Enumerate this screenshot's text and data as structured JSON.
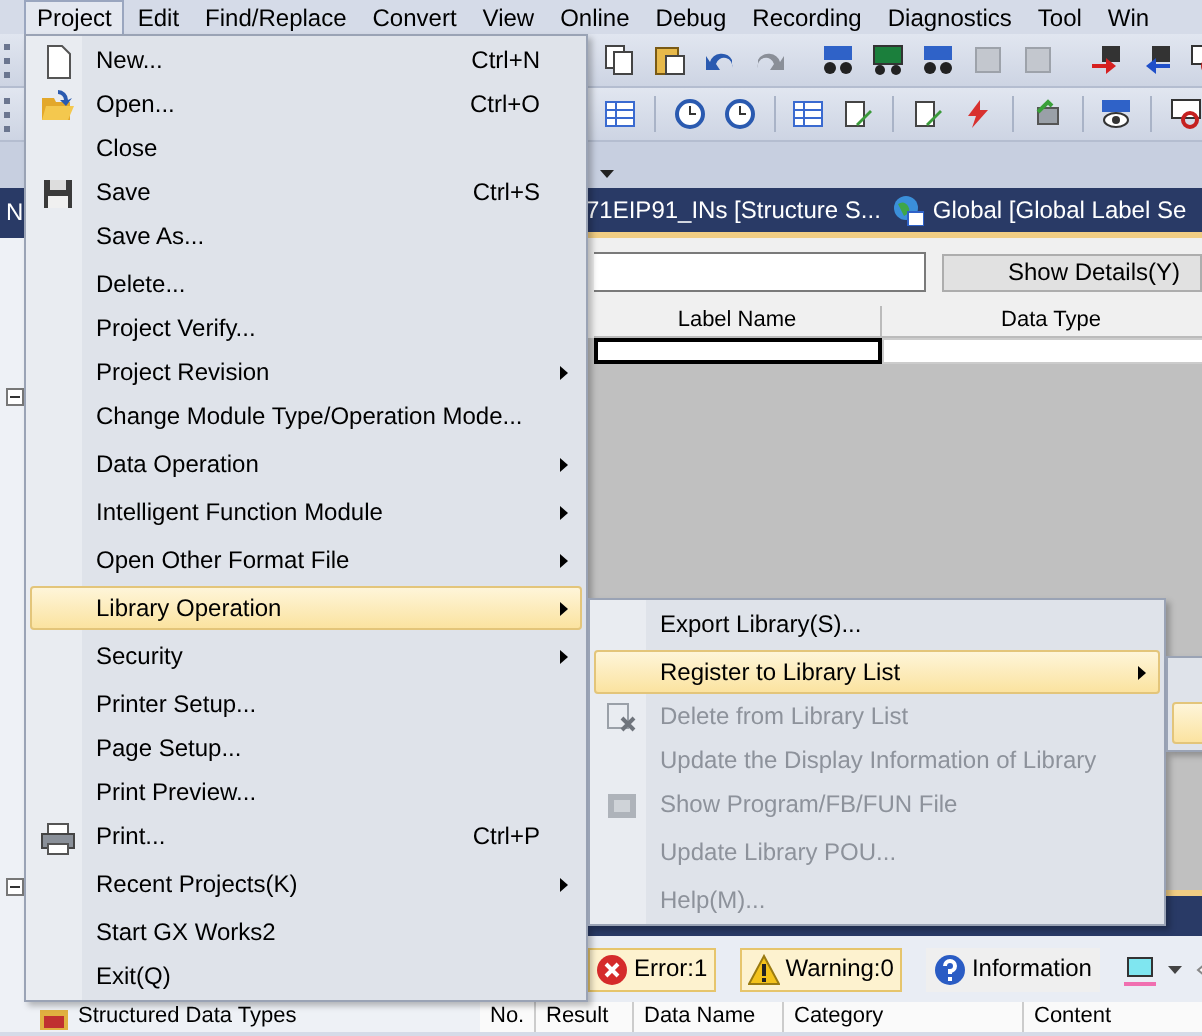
{
  "menubar": [
    {
      "label": "Project",
      "selected": true
    },
    {
      "label": "Edit",
      "selected": false
    },
    {
      "label": "Find/Replace",
      "selected": false
    },
    {
      "label": "Convert",
      "selected": false
    },
    {
      "label": "View",
      "selected": false
    },
    {
      "label": "Online",
      "selected": false
    },
    {
      "label": "Debug",
      "selected": false
    },
    {
      "label": "Recording",
      "selected": false
    },
    {
      "label": "Diagnostics",
      "selected": false
    },
    {
      "label": "Tool",
      "selected": false
    },
    {
      "label": "Win",
      "selected": false
    }
  ],
  "navigation": {
    "title": "N",
    "tree": [
      {
        "label": "Structured Data Types"
      }
    ]
  },
  "document_tabs": [
    {
      "label": "71EIP91_INs [Structure S..."
    },
    {
      "label": "Global [Global Label Se"
    }
  ],
  "label_editor": {
    "show_details_button": "Show Details(Y)",
    "columns": [
      "Label Name",
      "Data Type"
    ]
  },
  "output": {
    "filters": [
      {
        "kind": "error",
        "label": "Error:1",
        "selected": true
      },
      {
        "kind": "warning",
        "label": "Warning:0",
        "selected": true
      },
      {
        "kind": "information",
        "label": "Information",
        "selected": false
      }
    ],
    "columns": [
      "No.",
      "Result",
      "Data Name",
      "Category",
      "Content"
    ]
  },
  "project_menu": {
    "items": [
      {
        "kind": "item",
        "label": "New...",
        "shortcut": "Ctrl+N",
        "submenu": false,
        "selected": false
      },
      {
        "kind": "item",
        "label": "Open...",
        "shortcut": "Ctrl+O",
        "submenu": false,
        "selected": false
      },
      {
        "kind": "item",
        "label": "Close",
        "submenu": false,
        "selected": false
      },
      {
        "kind": "item",
        "label": "Save",
        "shortcut": "Ctrl+S",
        "submenu": false,
        "selected": false
      },
      {
        "kind": "item",
        "label": "Save As...",
        "submenu": false,
        "selected": false
      },
      {
        "kind": "separator"
      },
      {
        "kind": "item",
        "label": "Delete...",
        "submenu": false,
        "selected": false
      },
      {
        "kind": "item",
        "label": "Project Verify...",
        "submenu": false,
        "selected": false
      },
      {
        "kind": "item",
        "label": "Project Revision",
        "submenu": true,
        "selected": false
      },
      {
        "kind": "item",
        "label": "Change Module Type/Operation Mode...",
        "submenu": false,
        "selected": false
      },
      {
        "kind": "separator"
      },
      {
        "kind": "item",
        "label": "Data Operation",
        "submenu": true,
        "selected": false
      },
      {
        "kind": "separator"
      },
      {
        "kind": "item",
        "label": "Intelligent Function Module",
        "submenu": true,
        "selected": false
      },
      {
        "kind": "separator"
      },
      {
        "kind": "item",
        "label": "Open Other Format File",
        "submenu": true,
        "selected": false
      },
      {
        "kind": "separator"
      },
      {
        "kind": "item",
        "label": "Library Operation",
        "submenu": true,
        "selected": true
      },
      {
        "kind": "separator"
      },
      {
        "kind": "item",
        "label": "Security",
        "submenu": true,
        "selected": false
      },
      {
        "kind": "separator"
      },
      {
        "kind": "item",
        "label": "Printer Setup...",
        "submenu": false,
        "selected": false
      },
      {
        "kind": "item",
        "label": "Page Setup...",
        "submenu": false,
        "selected": false
      },
      {
        "kind": "item",
        "label": "Print Preview...",
        "submenu": false,
        "selected": false
      },
      {
        "kind": "item",
        "label": "Print...",
        "shortcut": "Ctrl+P",
        "submenu": false,
        "selected": false
      },
      {
        "kind": "separator"
      },
      {
        "kind": "item",
        "label": "Recent Projects(K)",
        "submenu": true,
        "selected": false
      },
      {
        "kind": "separator"
      },
      {
        "kind": "item",
        "label": "Start GX Works2",
        "submenu": false,
        "selected": false
      },
      {
        "kind": "item",
        "label": "Exit(Q)",
        "submenu": false,
        "selected": false
      }
    ]
  },
  "library_submenu": {
    "items": [
      {
        "kind": "item",
        "label": "Export Library(S)...",
        "submenu": false,
        "selected": false,
        "disabled": false
      },
      {
        "kind": "separator"
      },
      {
        "kind": "item",
        "label": "Register to Library List",
        "submenu": true,
        "selected": true,
        "disabled": false
      },
      {
        "kind": "item",
        "label": "Delete from Library List",
        "submenu": false,
        "selected": false,
        "disabled": true
      },
      {
        "kind": "item",
        "label": "Update the Display Information of Library",
        "submenu": false,
        "selected": false,
        "disabled": true
      },
      {
        "kind": "item",
        "label": "Show Program/FB/FUN File",
        "submenu": false,
        "selected": false,
        "disabled": true
      },
      {
        "kind": "separator"
      },
      {
        "kind": "item",
        "label": "Update Library POU...",
        "submenu": false,
        "selected": false,
        "disabled": true
      },
      {
        "kind": "separator"
      },
      {
        "kind": "item",
        "label": "Help(M)...",
        "submenu": false,
        "selected": false,
        "disabled": true
      }
    ]
  }
}
